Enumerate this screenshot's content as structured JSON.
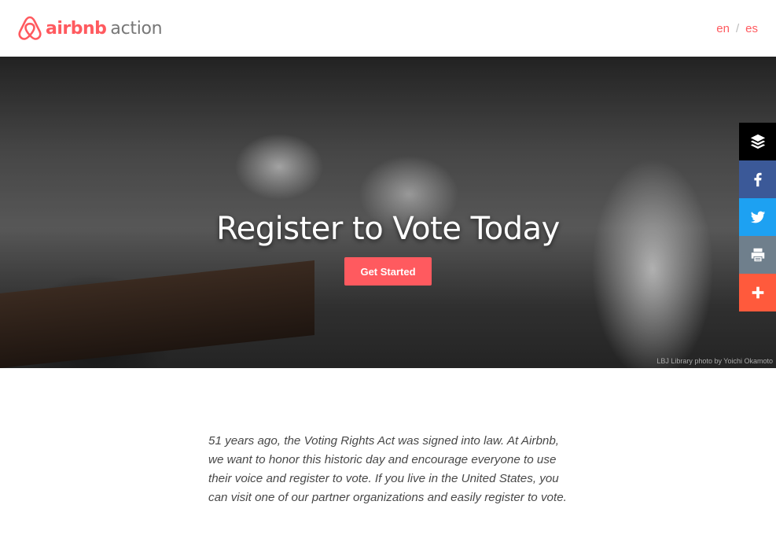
{
  "header": {
    "logo_brand": "airbnb",
    "logo_suffix": "action",
    "lang_en": "en",
    "lang_sep": "/",
    "lang_es": "es"
  },
  "hero": {
    "title": "Register to Vote Today",
    "cta_label": "Get Started",
    "credit": "LBJ Library photo by Yoichi Okamoto"
  },
  "share": {
    "buttons": [
      "buffer",
      "facebook",
      "twitter",
      "print",
      "more"
    ]
  },
  "intro": {
    "text": "51 years ago, the Voting Rights Act was signed into law. At Airbnb, we want to honor this historic day and encourage everyone to use their voice and register to vote. If you live in the United States, you can visit one of our partner organizations and easily register to vote."
  },
  "colors": {
    "brand": "#FF5A5F",
    "facebook": "#3B5998",
    "twitter": "#1DA1F2",
    "print": "#6F7F8C",
    "more": "#FF5A3C"
  }
}
